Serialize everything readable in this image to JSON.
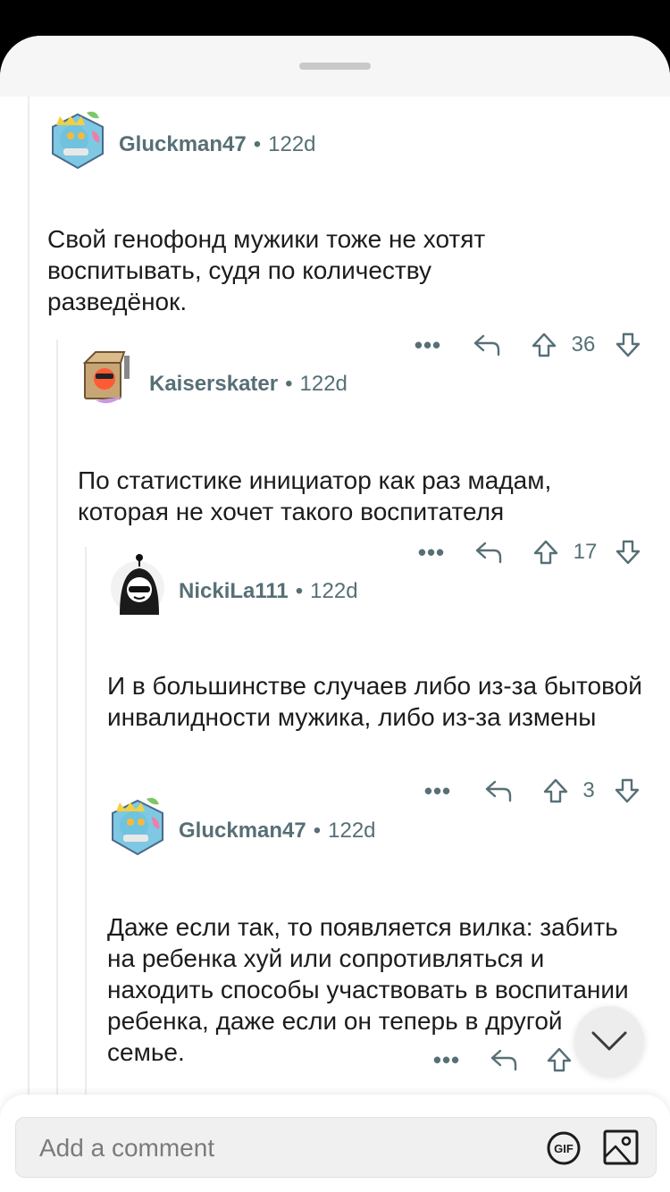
{
  "comments": [
    {
      "author": "Gluckman47",
      "age": "122d",
      "text": "Свой генофонд мужики тоже не хотят воспитывать, судя по количеству разведёнок.",
      "score": "36"
    },
    {
      "author": "Kaiserskater",
      "age": "122d",
      "text": "По статистике инициатор как раз мадам, которая не хочет такого воспитателя",
      "score": "17"
    },
    {
      "author": "NickiLa111",
      "age": "122d",
      "text": "И в большинстве случаев либо из-за бытовой инвалидности мужика, либо из-за измены",
      "score": "3"
    },
    {
      "author": "Gluckman47",
      "age": "122d",
      "text": "Даже если так, то появляется вилка: забить на ребенка хуй или сопротивляться и находить способы участвовать в воспитании ребенка, даже если он теперь в другой семье.",
      "score": ""
    }
  ],
  "actions": {
    "more": "•••",
    "separator": "•"
  },
  "composer": {
    "placeholder": "Add a comment",
    "gif_label": "GIF"
  },
  "colors": {
    "meta": "#576f76",
    "text": "#1c1c1c",
    "thread_line": "#ececec",
    "header_bg": "#f6f6f6"
  }
}
